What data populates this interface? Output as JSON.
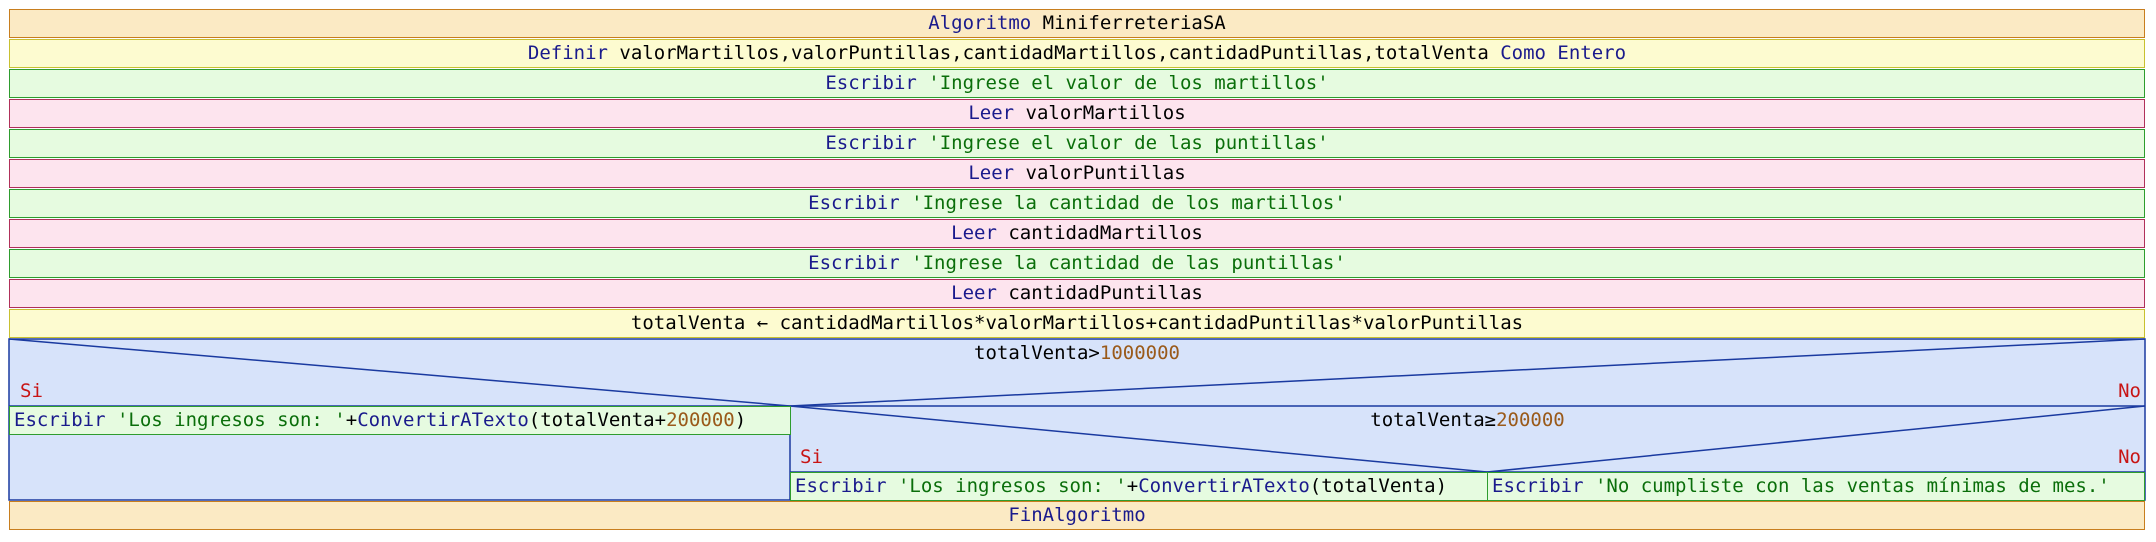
{
  "colors": {
    "algoritmo_bg": "#fbeac4",
    "algoritmo_border": "#c87e1e",
    "definir_bg": "#fdfbd0",
    "definir_border": "#c8c030",
    "escribir_bg": "#e6fbe0",
    "escribir_border": "#2e9c2e",
    "leer_bg": "#fde4ee",
    "leer_border": "#b0305a",
    "asignar_bg": "#fdfbd0",
    "asignar_border": "#c8c030",
    "si_bg": "#d7e3fa",
    "si_border": "#1a3aa0",
    "keyword": "#1a1a8c",
    "string": "#0a6e0a",
    "number": "#9a5a1a",
    "branch": "#c81414"
  },
  "rows": [
    {
      "type": "algoritmo",
      "parts": [
        {
          "c": "k",
          "t": "Algoritmo "
        },
        {
          "c": "v",
          "t": "MiniferreteriaSA"
        }
      ]
    },
    {
      "type": "definir",
      "parts": [
        {
          "c": "k",
          "t": "Definir "
        },
        {
          "c": "v",
          "t": "valorMartillos,valorPuntillas,cantidadMartillos,cantidadPuntillas,totalVenta "
        },
        {
          "c": "k",
          "t": "Como Entero"
        }
      ]
    },
    {
      "type": "escribir",
      "parts": [
        {
          "c": "k",
          "t": "Escribir "
        },
        {
          "c": "s",
          "t": "'Ingrese el valor de los martillos'"
        }
      ]
    },
    {
      "type": "leer",
      "parts": [
        {
          "c": "k",
          "t": "Leer "
        },
        {
          "c": "v",
          "t": "valorMartillos"
        }
      ]
    },
    {
      "type": "escribir",
      "parts": [
        {
          "c": "k",
          "t": "Escribir "
        },
        {
          "c": "s",
          "t": "'Ingrese el valor de las puntillas'"
        }
      ]
    },
    {
      "type": "leer",
      "parts": [
        {
          "c": "k",
          "t": "Leer "
        },
        {
          "c": "v",
          "t": "valorPuntillas"
        }
      ]
    },
    {
      "type": "escribir",
      "parts": [
        {
          "c": "k",
          "t": "Escribir "
        },
        {
          "c": "s",
          "t": "'Ingrese la cantidad de los martillos'"
        }
      ]
    },
    {
      "type": "leer",
      "parts": [
        {
          "c": "k",
          "t": "Leer "
        },
        {
          "c": "v",
          "t": "cantidadMartillos"
        }
      ]
    },
    {
      "type": "escribir",
      "parts": [
        {
          "c": "k",
          "t": "Escribir "
        },
        {
          "c": "s",
          "t": "'Ingrese la cantidad de las puntillas'"
        }
      ]
    },
    {
      "type": "leer",
      "parts": [
        {
          "c": "k",
          "t": "Leer "
        },
        {
          "c": "v",
          "t": "cantidadPuntillas"
        }
      ]
    },
    {
      "type": "asignar",
      "parts": [
        {
          "c": "v",
          "t": "totalVenta ← cantidadMartillos*valorMartillos+cantidadPuntillas*valorPuntillas"
        }
      ]
    }
  ],
  "outer_if": {
    "condition": [
      {
        "c": "v",
        "t": "totalVenta>"
      },
      {
        "c": "n",
        "t": "1000000"
      }
    ],
    "si_label": "Si",
    "no_label": "No",
    "si_action": [
      {
        "c": "k",
        "t": "Escribir "
      },
      {
        "c": "s",
        "t": "'Los ingresos son: '"
      },
      {
        "c": "v",
        "t": "+"
      },
      {
        "c": "k",
        "t": "ConvertirATexto"
      },
      {
        "c": "v",
        "t": "(totalVenta+"
      },
      {
        "c": "n",
        "t": "200000"
      },
      {
        "c": "v",
        "t": ")"
      }
    ]
  },
  "inner_if": {
    "condition": [
      {
        "c": "v",
        "t": "totalVenta≥"
      },
      {
        "c": "n",
        "t": "200000"
      }
    ],
    "si_label": "Si",
    "no_label": "No",
    "si_action": [
      {
        "c": "k",
        "t": "Escribir "
      },
      {
        "c": "s",
        "t": "'Los ingresos son: '"
      },
      {
        "c": "v",
        "t": "+"
      },
      {
        "c": "k",
        "t": "ConvertirATexto"
      },
      {
        "c": "v",
        "t": "(totalVenta)"
      }
    ],
    "no_action": [
      {
        "c": "k",
        "t": "Escribir "
      },
      {
        "c": "s",
        "t": "'No cumpliste con las ventas mínimas de mes.'"
      }
    ]
  },
  "end": {
    "type": "algoritmo",
    "parts": [
      {
        "c": "k",
        "t": "FinAlgoritmo"
      }
    ]
  }
}
